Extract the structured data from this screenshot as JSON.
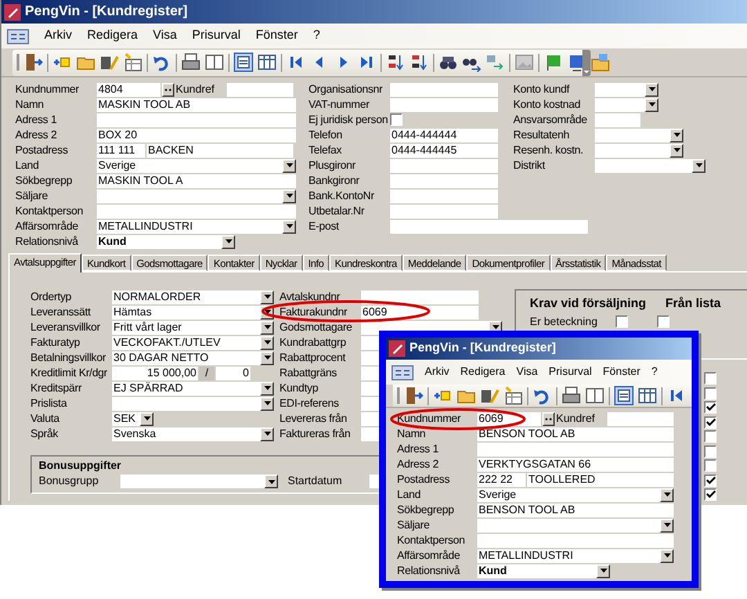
{
  "main_window": {
    "title": "PengVin - [Kundregister]",
    "menu": [
      "Arkiv",
      "Redigera",
      "Visa",
      "Prisurval",
      "Fönster",
      "?"
    ],
    "columns": [
      [
        {
          "label": "Kundnummer",
          "kind": "id",
          "value": "4804",
          "ref_label": "Kundref"
        },
        {
          "label": "Namn",
          "kind": "text",
          "value": "MASKIN TOOL AB"
        },
        {
          "label": "Adress 1",
          "kind": "text"
        },
        {
          "label": "Adress 2",
          "kind": "text",
          "value": "BOX 20"
        },
        {
          "label": "Postadress",
          "kind": "split",
          "values": [
            "111 111",
            "BACKEN"
          ]
        },
        {
          "label": "Land",
          "kind": "select",
          "value": "Sverige"
        },
        {
          "label": "Sökbegrepp",
          "kind": "text",
          "value": "MASKIN TOOL A"
        },
        {
          "label": "Säljare",
          "kind": "select"
        },
        {
          "label": "Kontaktperson",
          "kind": "text"
        },
        {
          "label": "Affärsområde",
          "kind": "select",
          "value": "METALLINDUSTRI"
        },
        {
          "label": "Relationsnivå",
          "kind": "level",
          "value": "Kund"
        }
      ],
      [
        {
          "label": "Organisationsnr",
          "kind": "text"
        },
        {
          "label": "VAT-nummer",
          "kind": "text"
        },
        {
          "label": "Ej juridisk person",
          "kind": "check",
          "checked": false
        },
        {
          "label": "Telefon",
          "kind": "text",
          "value": "0444-444444"
        },
        {
          "label": "Telefax",
          "kind": "text",
          "value": "0444-444445"
        },
        {
          "label": "Plusgironr",
          "kind": "text"
        },
        {
          "label": "Bankgironr",
          "kind": "text"
        },
        {
          "label": "Bank.KontoNr",
          "kind": "text"
        },
        {
          "label": "Utbetalar.Nr",
          "kind": "text"
        },
        {
          "label": "E-post",
          "kind": "text"
        }
      ],
      [
        {
          "label": "Konto kundf",
          "kind": "select"
        },
        {
          "label": "Konto kostnad",
          "kind": "select"
        },
        {
          "label": "Ansvarsområde",
          "kind": "text"
        },
        {
          "label": "Resultatenh",
          "kind": "select"
        },
        {
          "label": "Resenh. kostn.",
          "kind": "select"
        },
        {
          "label": "Distrikt",
          "kind": "select"
        }
      ]
    ],
    "tabs": [
      {
        "label": "Avtalsuppgifter",
        "selected": true
      },
      {
        "label": "Kundkort",
        "selected": false
      },
      {
        "label": "Godsmottagare",
        "selected": false
      },
      {
        "label": "Kontakter",
        "selected": false
      },
      {
        "label": "Nycklar",
        "selected": false
      },
      {
        "label": "Info",
        "selected": false
      },
      {
        "label": "Kundreskontra",
        "selected": false
      },
      {
        "label": "Meddelande",
        "selected": false
      },
      {
        "label": "Dokumentprofiler",
        "selected": false
      },
      {
        "label": "Årsstatistik",
        "selected": false
      },
      {
        "label": "Månadsstat",
        "selected": false
      }
    ],
    "agreement_left": [
      {
        "label": "Ordertyp",
        "kind": "select",
        "value": "NORMALORDER"
      },
      {
        "label": "Leveranssätt",
        "kind": "select",
        "value": "Hämtas"
      },
      {
        "label": "Leveransvillkor",
        "kind": "select",
        "value": "Fritt vårt lager"
      },
      {
        "label": "Fakturatyp",
        "kind": "select",
        "value": "VECKOFAKT./UTLEV"
      },
      {
        "label": "Betalningsvillkor",
        "kind": "select",
        "value": "30 DAGAR NETTO"
      },
      {
        "label": "Kreditlimit Kr/dgr",
        "kind": "credit",
        "value": "15 000,00",
        "separator": "/",
        "days": "0"
      },
      {
        "label": "Kreditspärr",
        "kind": "select",
        "value": "EJ SPÄRRAD"
      },
      {
        "label": "Prislista",
        "kind": "select"
      },
      {
        "label": "Valuta",
        "kind": "select",
        "value": "SEK"
      },
      {
        "label": "Språk",
        "kind": "select",
        "value": "Svenska"
      }
    ],
    "agreement_right": [
      {
        "label": "Avtalskundnr",
        "kind": "text"
      },
      {
        "label": "Fakturakundnr",
        "kind": "text",
        "value": "6069"
      },
      {
        "label": "Godsmottagare",
        "kind": "select"
      },
      {
        "label": "Kundrabattgrp",
        "kind": "text"
      },
      {
        "label": "Rabattprocent",
        "kind": "text"
      },
      {
        "label": "Rabattgräns",
        "kind": "text"
      },
      {
        "label": "Kundtyp",
        "kind": "text"
      },
      {
        "label": "EDI-referens",
        "kind": "text"
      },
      {
        "label": "Levereras från",
        "kind": "text"
      },
      {
        "label": "Faktureras från",
        "kind": "text"
      }
    ],
    "requirements": {
      "title": "Krav vid försäljning",
      "from_list_title": "Från lista",
      "rows": [
        {
          "label": "Er beteckning",
          "required": false,
          "from_list": false
        }
      ]
    },
    "option_checks": [
      {
        "checked": false
      },
      {
        "checked": false
      },
      {
        "checked": true
      },
      {
        "checked": true
      },
      {
        "checked": false
      },
      {
        "checked": false
      },
      {
        "checked": false
      },
      {
        "checked": true
      },
      {
        "checked": true
      }
    ],
    "bonus": {
      "title": "Bonusuppgifter",
      "group_label": "Bonusgrupp",
      "start_label": "Startdatum"
    }
  },
  "front_window": {
    "title": "PengVin - [Kundregister]",
    "menu": [
      "Arkiv",
      "Redigera",
      "Visa",
      "Prisurval",
      "Fönster",
      "?"
    ],
    "rows": [
      {
        "label": "Kundnummer",
        "kind": "id",
        "value": "6069",
        "ref_label": "Kundref"
      },
      {
        "label": "Namn",
        "kind": "text",
        "value": "BENSON TOOL AB"
      },
      {
        "label": "Adress 1",
        "kind": "text"
      },
      {
        "label": "Adress 2",
        "kind": "text",
        "value": "VERKTYGSGATAN 66"
      },
      {
        "label": "Postadress",
        "kind": "split",
        "values": [
          "222 22",
          "TOOLLERED"
        ]
      },
      {
        "label": "Land",
        "kind": "select",
        "value": "Sverige"
      },
      {
        "label": "Sökbegrepp",
        "kind": "text",
        "value": "BENSON TOOL AB"
      },
      {
        "label": "Säljare",
        "kind": "select"
      },
      {
        "label": "Kontaktperson",
        "kind": "text"
      },
      {
        "label": "Affärsområde",
        "kind": "select",
        "value": "METALLINDUSTRI"
      },
      {
        "label": "Relationsnivå",
        "kind": "level",
        "value": "Kund"
      }
    ]
  }
}
